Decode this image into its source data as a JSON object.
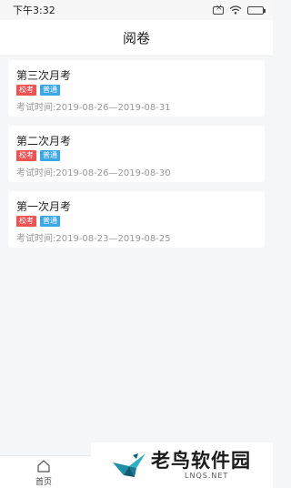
{
  "status_bar": {
    "time": "下午3:32"
  },
  "nav": {
    "title": "阅卷"
  },
  "exams": [
    {
      "title": "第三次月考",
      "tags": [
        "校考",
        "普通"
      ],
      "time": "考试时间:2019-08-26—2019-08-31"
    },
    {
      "title": "第二次月考",
      "tags": [
        "校考",
        "普通"
      ],
      "time": "考试时间:2019-08-26—2019-08-30"
    },
    {
      "title": "第一次月考",
      "tags": [
        "校考",
        "普通"
      ],
      "time": "考试时间:2019-08-23—2019-08-25"
    }
  ],
  "tab_bar": {
    "home_label": "首页",
    "home_icon": "home-icon"
  },
  "watermark": {
    "name": "老鸟软件园",
    "domain": "LNQS.NET"
  },
  "colors": {
    "tag_red": "#f05252",
    "tag_blue": "#3ba6e8",
    "background": "#f5f6f8"
  }
}
